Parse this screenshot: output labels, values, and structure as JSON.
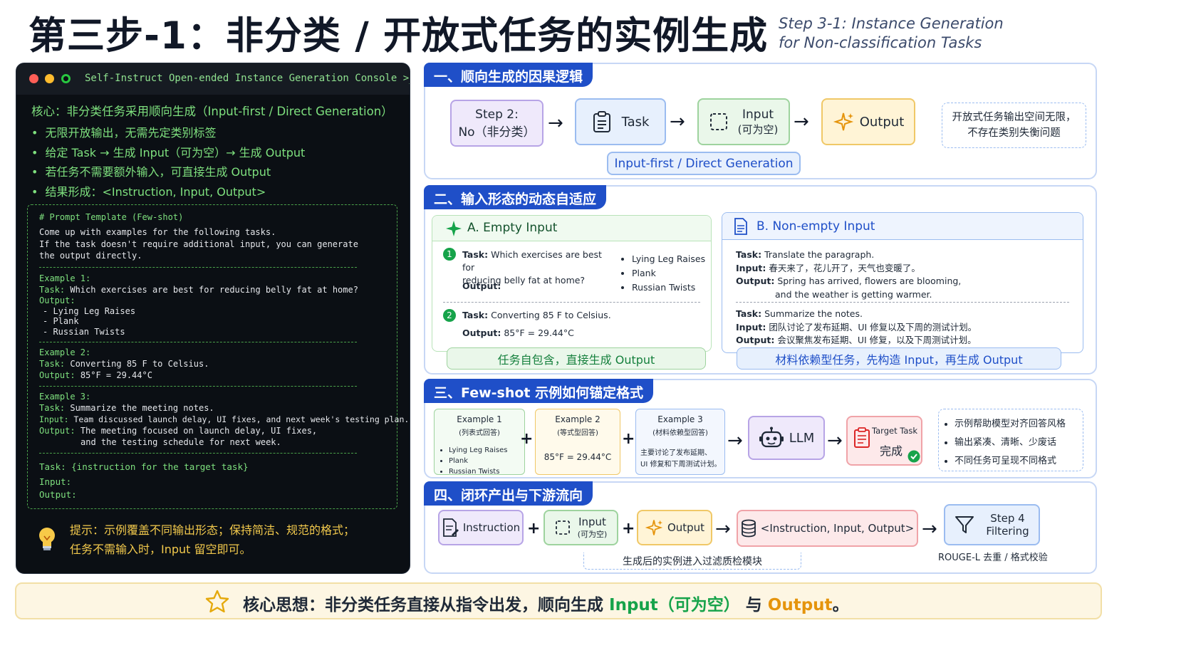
{
  "header": {
    "title": "第三步-1：非分类 / 开放式任务的实例生成",
    "subtitle_line1": "Step 3-1: Instance Generation",
    "subtitle_line2": "for Non-classification Tasks"
  },
  "console": {
    "title": "Self-Instruct Open-ended Instance Generation Console >_",
    "core": "核心：非分类任务采用顺向生成（Input-first / Direct Generation）",
    "bullets": [
      "无限开放输出，无需先定类别标签",
      "给定 Task → 生成 Input（可为空）→ 生成 Output",
      "若任务不需要额外输入，可直接生成 Output",
      "结果形成：<Instruction, Input, Output>"
    ],
    "prompt": {
      "comment": "# Prompt Template (Few-shot)",
      "intro1": "Come up with examples for the following tasks.",
      "intro2": "If the task doesn't require additional input, you can generate",
      "intro3": "the output directly.",
      "ex1_label": "Example 1:",
      "ex1_task_label": "Task:",
      "ex1_task": "Which exercises are best for reducing belly fat at home?",
      "ex1_output_label": "Output:",
      "ex1_items": [
        "- Lying Leg Raises",
        "- Plank",
        "- Russian Twists"
      ],
      "ex2_label": "Example 2:",
      "ex2_task_label": "Task:",
      "ex2_task": "Converting 85 F to Celsius.",
      "ex2_output_label": "Output:",
      "ex2_output": "85°F = 29.44°C",
      "ex3_label": "Example 3:",
      "ex3_task_label": "Task:",
      "ex3_task": "Summarize the meeting notes.",
      "ex3_input_label": "Input:",
      "ex3_input": "Team discussed launch delay, UI fixes, and next week's testing plan.",
      "ex3_output_label": "Output:",
      "ex3_output1": "The meeting focused on launch delay, UI fixes,",
      "ex3_output2": "and the testing schedule for next week.",
      "target_task": "Task: {instruction for the target task}",
      "target_input": "Input:",
      "target_output": "Output:"
    },
    "tip_line1": "提示：示例覆盖不同输出形态；保持简洁、规范的格式；",
    "tip_line2": "任务不需输入时，Input 留空即可。"
  },
  "section1": {
    "heading": "一、顺向生成的因果逻辑",
    "step_line1": "Step 2:",
    "step_line2": "No（非分类）",
    "task": "Task",
    "input_line1": "Input",
    "input_line2": "(可为空)",
    "output": "Output",
    "note_line1": "开放式任务输出空间无限，",
    "note_line2": "不存在类别失衡问题",
    "method": "Input-first / Direct Generation"
  },
  "section2": {
    "heading": "二、输入形态的动态自适应",
    "a_title": "A. Empty Input",
    "a1_num": "1",
    "a1_task_label": "Task:",
    "a1_task_line1": "Which exercises are best for",
    "a1_task_line2": "reducing belly fat at home?",
    "a1_output_label": "Output:",
    "a1_items": [
      "Lying Leg Raises",
      "Plank",
      "Russian Twists"
    ],
    "a2_num": "2",
    "a2_task_label": "Task:",
    "a2_task": "Converting 85 F to Celsius.",
    "a2_output_label": "Output:",
    "a2_output": "85°F = 29.44°C",
    "a_footer": "任务自包含，直接生成 Output",
    "b_title": "B. Non-empty Input",
    "b1_task_label": "Task:",
    "b1_task": "Translate the paragraph.",
    "b1_input_label": "Input:",
    "b1_input": "春天来了，花儿开了，天气也变暖了。",
    "b1_output_label": "Output:",
    "b1_output_line1": "Spring has arrived, flowers are blooming,",
    "b1_output_line2": "and the weather is getting warmer.",
    "b2_task_label": "Task:",
    "b2_task": "Summarize the notes.",
    "b2_input_label": "Input:",
    "b2_input": "团队讨论了发布延期、UI 修复以及下周的测试计划。",
    "b2_output_label": "Output:",
    "b2_output": "会议聚焦发布延期、UI 修复，以及下周测试计划。",
    "b_footer": "材料依赖型任务，先构造 Input，再生成 Output"
  },
  "section3": {
    "heading": "三、Few-shot 示例如何锚定格式",
    "ex1_title": "Example 1",
    "ex1_sub": "(列表式回答)",
    "ex1_items": [
      "Lying Leg Raises",
      "Plank",
      "Russian Twists"
    ],
    "ex2_title": "Example 2",
    "ex2_sub": "(等式型回答)",
    "ex2_body": "85°F = 29.44°C",
    "ex3_title": "Example 3",
    "ex3_sub": "(材料依赖型回答)",
    "ex3_body_line1": "主要讨论了发布延期、",
    "ex3_body_line2": "UI 修复和下周测试计划。",
    "llm": "LLM",
    "target_line1": "Target Task",
    "target_line2": "完成",
    "notes": [
      "示例帮助模型对齐回答风格",
      "输出紧凑、清晰、少废话",
      "不同任务可呈现不同格式"
    ]
  },
  "section4": {
    "heading": "四、闭环产出与下游流向",
    "instruction": "Instruction",
    "input_line1": "Input",
    "input_line2": "(可为空)",
    "output": "Output",
    "triple": "<Instruction, Input, Output>",
    "step4_line1": "Step 4",
    "step4_line2": "Filtering",
    "filter_note": "ROUGE-L 去重 / 格式校验",
    "footer": "生成后的实例进入过滤质检模块"
  },
  "bottom": {
    "prefix": "核心思想：非分类任务直接从指令出发，顺向生成 ",
    "input": "Input（可为空）",
    "middle": " 与 ",
    "output": "Output",
    "suffix": "。"
  },
  "colors": {
    "section_head": "#1f4fc8",
    "console_bg": "#0b0f14",
    "console_green": "#7ee07e",
    "tip_yellow": "#f2c94c",
    "purple_box": "#efe9fb",
    "blue_box": "#e7f0fd",
    "green_box": "#eaf7ea",
    "yellow_box": "#fff4d6",
    "red_box": "#fde9ea",
    "accent_green": "#16a34a",
    "accent_orange": "#e5940c"
  }
}
